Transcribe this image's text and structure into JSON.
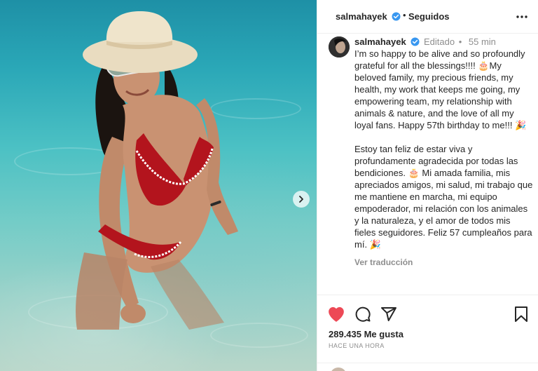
{
  "header": {
    "username": "salmahayek",
    "separator": "•",
    "follow_status": "Seguidos"
  },
  "caption": {
    "username": "salmahayek",
    "edited": "Editado",
    "separator": "•",
    "age": "55 min",
    "english": "I’m so happy to be alive and so profoundly grateful for all the blessings!!!! 🎂My beloved family, my precious friends, my health, my work that keeps me going, my empowering team, my relationship with animals & nature, and the love of all my loyal fans. Happy 57th birthday to me!!! 🎉",
    "spanish": "Estoy tan feliz de estar viva y profundamente agradecida por todas las bendiciones. 🎂 Mi amada familia, mis apreciados amigos, mi salud, mi trabajo que me mantiene en marcha, mi equipo empoderador, mi relación con los animales y la naturaleza, y el amor de todos mis fieles seguidores. Feliz 57 cumpleaños para mí. 🎉",
    "translate_link": "Ver traducción"
  },
  "actions": {
    "likes": "289.435 Me gusta",
    "posted": "HACE UNA HORA"
  },
  "icons": {
    "verified": "verified-badge-icon",
    "more": "more-horizontal-icon",
    "like": "heart-filled-icon",
    "comment": "comment-bubble-icon",
    "share": "paper-plane-icon",
    "save": "bookmark-icon",
    "carousel": "chevron-right-icon"
  },
  "colors": {
    "like_red": "#ed4956",
    "verified_blue": "#3897f0",
    "muted_text": "#8e8e8e"
  }
}
